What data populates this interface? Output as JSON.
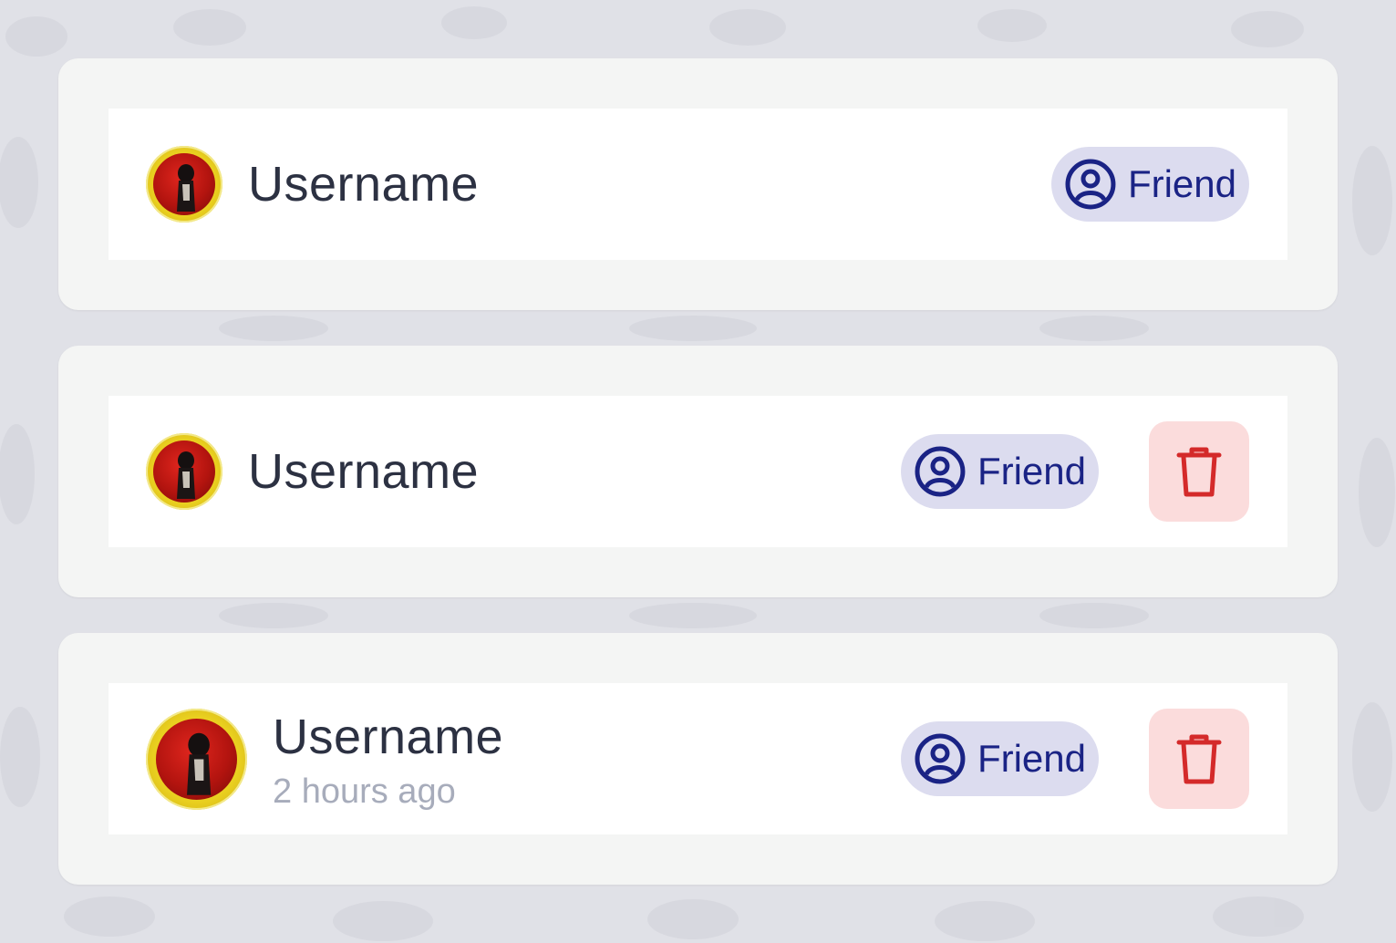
{
  "colors": {
    "background": "#e0e1e7",
    "card": "#f4f5f4",
    "row": "#ffffff",
    "friend_badge_bg": "#dcdcef",
    "friend_badge_text": "#1a2385",
    "delete_bg": "#fbdcdc",
    "delete_icon": "#d42a2a",
    "username_text": "#2c3142",
    "timestamp_text": "#a7acbb"
  },
  "cards": [
    {
      "username": "Username",
      "badge": {
        "label": "Friend",
        "icon": "user-circle-icon"
      }
    },
    {
      "username": "Username",
      "badge": {
        "label": "Friend",
        "icon": "user-circle-icon"
      },
      "delete_icon": "trash-icon"
    },
    {
      "username": "Username",
      "timestamp": "2 hours ago",
      "badge": {
        "label": "Friend",
        "icon": "user-circle-icon"
      },
      "delete_icon": "trash-icon"
    }
  ]
}
